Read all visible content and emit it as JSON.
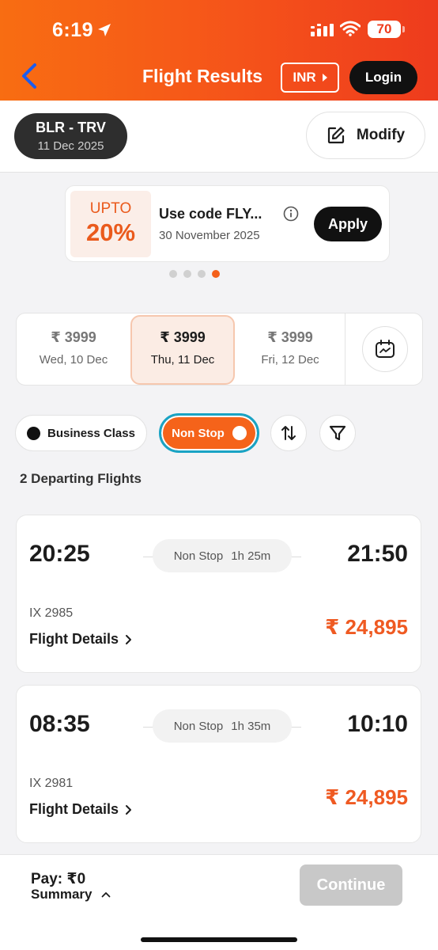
{
  "status_bar": {
    "time": "6:19",
    "battery": "70"
  },
  "header": {
    "title": "Flight Results",
    "currency": "INR",
    "login_label": "Login"
  },
  "route": {
    "code": "BLR - TRV",
    "date": "11 Dec 2025",
    "modify_label": "Modify"
  },
  "promo": {
    "upto_label": "UPTO",
    "percent": "20%",
    "code_text": "Use code FLY...",
    "date": "30 November 2025",
    "apply_label": "Apply",
    "page_count": 4,
    "active_page": 4
  },
  "date_strip": [
    {
      "price": "₹ 3999",
      "day": "Wed, 10 Dec",
      "selected": false
    },
    {
      "price": "₹ 3999",
      "day": "Thu, 11 Dec",
      "selected": true
    },
    {
      "price": "₹ 3999",
      "day": "Fri, 12 Dec",
      "selected": false
    }
  ],
  "filters": {
    "business_label": "Business Class",
    "nonstop_label": "Non Stop"
  },
  "results": {
    "count_label": "2 Departing Flights"
  },
  "flights": [
    {
      "dep_time": "20:25",
      "arr_time": "21:50",
      "stop_label": "Non Stop",
      "duration": "1h 25m",
      "flight_no": "IX 2985",
      "details_label": "Flight Details",
      "price": "₹ 24,895"
    },
    {
      "dep_time": "08:35",
      "arr_time": "10:10",
      "stop_label": "Non Stop",
      "duration": "1h 35m",
      "flight_no": "IX 2981",
      "details_label": "Flight Details",
      "price": "₹ 24,895"
    }
  ],
  "bottom_bar": {
    "pay_label": "Pay: ₹0",
    "summary_label": "Summary",
    "continue_label": "Continue"
  },
  "colors": {
    "accent": "#f5631a",
    "price": "#ef5a22",
    "dark": "#111111",
    "focus_ring": "#19a3c4"
  },
  "icons": [
    "location-arrow-icon",
    "signal-icon",
    "wifi-icon",
    "back-chevron-icon",
    "caret-right-icon",
    "edit-icon",
    "info-icon",
    "calendar-icon",
    "sort-icon",
    "filter-icon",
    "chevron-right-icon",
    "chevron-up-icon"
  ]
}
